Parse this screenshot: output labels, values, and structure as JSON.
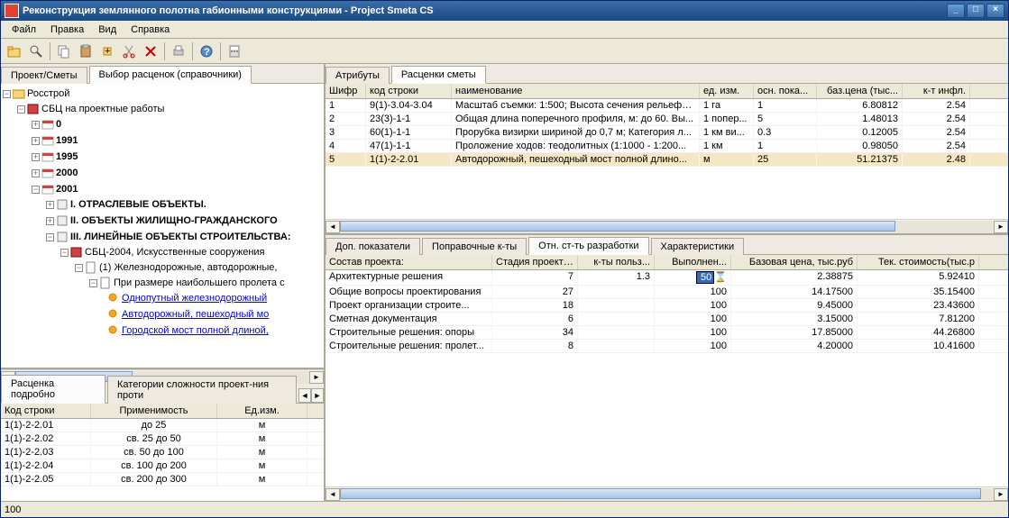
{
  "title": "Реконструкция землянного полотна габионными конструкциями - Project Smeta CS",
  "menu": {
    "file": "Файл",
    "edit": "Правка",
    "view": "Вид",
    "help": "Справка"
  },
  "leftTabs": {
    "t1": "Проект/Сметы",
    "t2": "Выбор расценок (справочники)"
  },
  "tree": {
    "root": "Росстрой",
    "sbc": "СБЦ на проектные работы",
    "y0": "0",
    "y1991": "1991",
    "y1995": "1995",
    "y2000": "2000",
    "y2001": "2001",
    "sec1": "I.  ОТРАСЛЕВЫЕ ОБЪЕКТЫ.",
    "sec2": "II.  ОБЪЕКТЫ ЖИЛИЩНО-ГРАЖДАНСКОГО",
    "sec3": "III. ЛИНЕЙНЫЕ ОБЪЕКТЫ СТРОИТЕЛЬСТВА:",
    "sbc2004": "СБЦ-2004, Искусственные сооружения",
    "road": "(1) Железнодорожные, автодорожные,",
    "span": "При размере наибольшего пролета с",
    "l1": "Однопутный железнодорожный",
    "l2": "Автодорожный, пешеходный мо",
    "l3": "Городской мост полной длиной,"
  },
  "lowerLeftTabs": {
    "t1": "Расценка подробно",
    "t2": "Категории сложности проект-ния проти"
  },
  "lowerLeftCols": {
    "c1": "Код строки",
    "c2": "Применимость",
    "c3": "Ед.изм."
  },
  "lowerLeftRows": [
    {
      "code": "1(1)-2-2.01",
      "appl": "до 25",
      "unit": "м"
    },
    {
      "code": "1(1)-2-2.02",
      "appl": "св. 25 до 50",
      "unit": "м"
    },
    {
      "code": "1(1)-2-2.03",
      "appl": "св. 50 до 100",
      "unit": "м"
    },
    {
      "code": "1(1)-2-2.04",
      "appl": "св. 100 до 200",
      "unit": "м"
    },
    {
      "code": "1(1)-2-2.05",
      "appl": "св. 200 до 300",
      "unit": "м"
    }
  ],
  "upperRightTabs": {
    "t1": "Атрибуты",
    "t2": "Расценки сметы"
  },
  "upperCols": {
    "c1": "Шифр",
    "c2": "код строки",
    "c3": "наименование",
    "c4": "ед. изм.",
    "c5": "осн. пока...",
    "c6": "баз.цена (тыс...",
    "c7": "к-т инфл."
  },
  "upperRows": [
    {
      "n": "1",
      "code": "9(1)-3.04-3.04",
      "name": "Масштаб съемки: 1:500; Высота сечения рельефа...",
      "unit": "1 га",
      "base": "1",
      "price": "6.80812",
      "infl": "2.54"
    },
    {
      "n": "2",
      "code": "23(3)-1-1",
      "name": "Общая длина поперечного профиля, м: до 60. Вы...",
      "unit": "1 попер...",
      "base": "5",
      "price": "1.48013",
      "infl": "2.54"
    },
    {
      "n": "3",
      "code": "60(1)-1-1",
      "name": "Прорубка визирки шириной до 0,7 м; Категория л...",
      "unit": "1 км ви...",
      "base": "0.3",
      "price": "0.12005",
      "infl": "2.54"
    },
    {
      "n": "4",
      "code": "47(1)-1-1",
      "name": "Проложение ходов: теодолитных (1:1000 - 1:200...",
      "unit": "1 км",
      "base": "1",
      "price": "0.98050",
      "infl": "2.54"
    },
    {
      "n": "5",
      "code": "1(1)-2-2.01",
      "name": "Автодорожный, пешеходный мост полной длино...",
      "unit": "м",
      "base": "25",
      "price": "51.21375",
      "infl": "2.48"
    }
  ],
  "lowerRightTabs": {
    "t1": "Доп. показатели",
    "t2": "Поправочные к-ты",
    "t3": "Отн. ст-ть разработки",
    "t4": "Характеристики"
  },
  "lowerCols": {
    "c1": "Состав проекта:",
    "c2": "Стадия проекти...",
    "c3": "к-ты польз...",
    "c4": "Выполнен...",
    "c5": "Базовая цена, тыс.руб",
    "c6": "Тек. стоимость(тыс.р"
  },
  "lowerRows": [
    {
      "name": "Архитектурные решения",
      "stage": "7",
      "coef": "1.3",
      "done": "50",
      "bprice": "2.38875",
      "cur": "5.92410"
    },
    {
      "name": "Общие вопросы проектирования",
      "stage": "27",
      "coef": "",
      "done": "100",
      "bprice": "14.17500",
      "cur": "35.15400"
    },
    {
      "name": "Проект организации строите...",
      "stage": "18",
      "coef": "",
      "done": "100",
      "bprice": "9.45000",
      "cur": "23.43600"
    },
    {
      "name": "Сметная документация",
      "stage": "6",
      "coef": "",
      "done": "100",
      "bprice": "3.15000",
      "cur": "7.81200"
    },
    {
      "name": "Строительные решения: опоры",
      "stage": "34",
      "coef": "",
      "done": "100",
      "bprice": "17.85000",
      "cur": "44.26800"
    },
    {
      "name": "Строительные решения: пролет...",
      "stage": "8",
      "coef": "",
      "done": "100",
      "bprice": "4.20000",
      "cur": "10.41600"
    }
  ],
  "status": "100"
}
